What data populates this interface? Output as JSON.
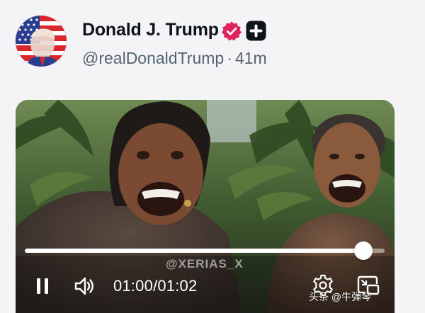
{
  "post": {
    "author": {
      "display_name": "Donald J. Trump",
      "handle": "@realDonaldTrump",
      "separator": "·",
      "time_ago": "41m",
      "verified_icon": "verified-badge-icon",
      "extra_badge_icon": "plus-badge-icon"
    },
    "video": {
      "watermark": "@XERIAS_X",
      "progress": 0.94,
      "current_time": "01:00",
      "duration_separator": "/",
      "duration": "01:02",
      "controls": {
        "pause_icon": "pause-icon",
        "volume_icon": "volume-icon",
        "settings_icon": "settings-gear-icon",
        "pip_icon": "picture-in-picture-icon"
      }
    },
    "source_tag": "头条 @牛弹琴"
  },
  "colors": {
    "name_text": "#0f1419",
    "secondary_text": "#536471",
    "verified_badge": "#e0245e",
    "page_background": "#f4f4f6"
  }
}
